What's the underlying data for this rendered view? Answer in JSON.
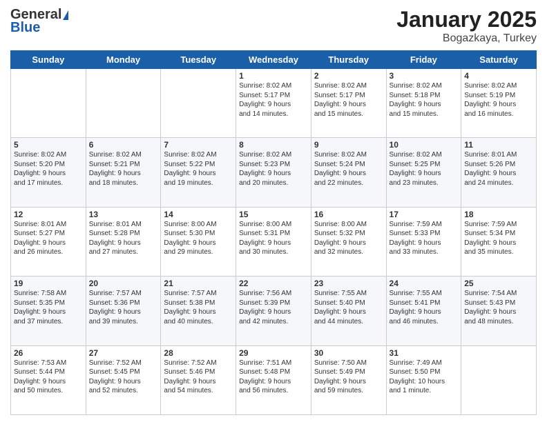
{
  "header": {
    "logo_general": "General",
    "logo_blue": "Blue",
    "month": "January 2025",
    "location": "Bogazkaya, Turkey"
  },
  "days_of_week": [
    "Sunday",
    "Monday",
    "Tuesday",
    "Wednesday",
    "Thursday",
    "Friday",
    "Saturday"
  ],
  "weeks": [
    [
      {
        "day": "",
        "info": ""
      },
      {
        "day": "",
        "info": ""
      },
      {
        "day": "",
        "info": ""
      },
      {
        "day": "1",
        "info": "Sunrise: 8:02 AM\nSunset: 5:17 PM\nDaylight: 9 hours\nand 14 minutes."
      },
      {
        "day": "2",
        "info": "Sunrise: 8:02 AM\nSunset: 5:17 PM\nDaylight: 9 hours\nand 15 minutes."
      },
      {
        "day": "3",
        "info": "Sunrise: 8:02 AM\nSunset: 5:18 PM\nDaylight: 9 hours\nand 15 minutes."
      },
      {
        "day": "4",
        "info": "Sunrise: 8:02 AM\nSunset: 5:19 PM\nDaylight: 9 hours\nand 16 minutes."
      }
    ],
    [
      {
        "day": "5",
        "info": "Sunrise: 8:02 AM\nSunset: 5:20 PM\nDaylight: 9 hours\nand 17 minutes."
      },
      {
        "day": "6",
        "info": "Sunrise: 8:02 AM\nSunset: 5:21 PM\nDaylight: 9 hours\nand 18 minutes."
      },
      {
        "day": "7",
        "info": "Sunrise: 8:02 AM\nSunset: 5:22 PM\nDaylight: 9 hours\nand 19 minutes."
      },
      {
        "day": "8",
        "info": "Sunrise: 8:02 AM\nSunset: 5:23 PM\nDaylight: 9 hours\nand 20 minutes."
      },
      {
        "day": "9",
        "info": "Sunrise: 8:02 AM\nSunset: 5:24 PM\nDaylight: 9 hours\nand 22 minutes."
      },
      {
        "day": "10",
        "info": "Sunrise: 8:02 AM\nSunset: 5:25 PM\nDaylight: 9 hours\nand 23 minutes."
      },
      {
        "day": "11",
        "info": "Sunrise: 8:01 AM\nSunset: 5:26 PM\nDaylight: 9 hours\nand 24 minutes."
      }
    ],
    [
      {
        "day": "12",
        "info": "Sunrise: 8:01 AM\nSunset: 5:27 PM\nDaylight: 9 hours\nand 26 minutes."
      },
      {
        "day": "13",
        "info": "Sunrise: 8:01 AM\nSunset: 5:28 PM\nDaylight: 9 hours\nand 27 minutes."
      },
      {
        "day": "14",
        "info": "Sunrise: 8:00 AM\nSunset: 5:30 PM\nDaylight: 9 hours\nand 29 minutes."
      },
      {
        "day": "15",
        "info": "Sunrise: 8:00 AM\nSunset: 5:31 PM\nDaylight: 9 hours\nand 30 minutes."
      },
      {
        "day": "16",
        "info": "Sunrise: 8:00 AM\nSunset: 5:32 PM\nDaylight: 9 hours\nand 32 minutes."
      },
      {
        "day": "17",
        "info": "Sunrise: 7:59 AM\nSunset: 5:33 PM\nDaylight: 9 hours\nand 33 minutes."
      },
      {
        "day": "18",
        "info": "Sunrise: 7:59 AM\nSunset: 5:34 PM\nDaylight: 9 hours\nand 35 minutes."
      }
    ],
    [
      {
        "day": "19",
        "info": "Sunrise: 7:58 AM\nSunset: 5:35 PM\nDaylight: 9 hours\nand 37 minutes."
      },
      {
        "day": "20",
        "info": "Sunrise: 7:57 AM\nSunset: 5:36 PM\nDaylight: 9 hours\nand 39 minutes."
      },
      {
        "day": "21",
        "info": "Sunrise: 7:57 AM\nSunset: 5:38 PM\nDaylight: 9 hours\nand 40 minutes."
      },
      {
        "day": "22",
        "info": "Sunrise: 7:56 AM\nSunset: 5:39 PM\nDaylight: 9 hours\nand 42 minutes."
      },
      {
        "day": "23",
        "info": "Sunrise: 7:55 AM\nSunset: 5:40 PM\nDaylight: 9 hours\nand 44 minutes."
      },
      {
        "day": "24",
        "info": "Sunrise: 7:55 AM\nSunset: 5:41 PM\nDaylight: 9 hours\nand 46 minutes."
      },
      {
        "day": "25",
        "info": "Sunrise: 7:54 AM\nSunset: 5:43 PM\nDaylight: 9 hours\nand 48 minutes."
      }
    ],
    [
      {
        "day": "26",
        "info": "Sunrise: 7:53 AM\nSunset: 5:44 PM\nDaylight: 9 hours\nand 50 minutes."
      },
      {
        "day": "27",
        "info": "Sunrise: 7:52 AM\nSunset: 5:45 PM\nDaylight: 9 hours\nand 52 minutes."
      },
      {
        "day": "28",
        "info": "Sunrise: 7:52 AM\nSunset: 5:46 PM\nDaylight: 9 hours\nand 54 minutes."
      },
      {
        "day": "29",
        "info": "Sunrise: 7:51 AM\nSunset: 5:48 PM\nDaylight: 9 hours\nand 56 minutes."
      },
      {
        "day": "30",
        "info": "Sunrise: 7:50 AM\nSunset: 5:49 PM\nDaylight: 9 hours\nand 59 minutes."
      },
      {
        "day": "31",
        "info": "Sunrise: 7:49 AM\nSunset: 5:50 PM\nDaylight: 10 hours\nand 1 minute."
      },
      {
        "day": "",
        "info": ""
      }
    ]
  ]
}
